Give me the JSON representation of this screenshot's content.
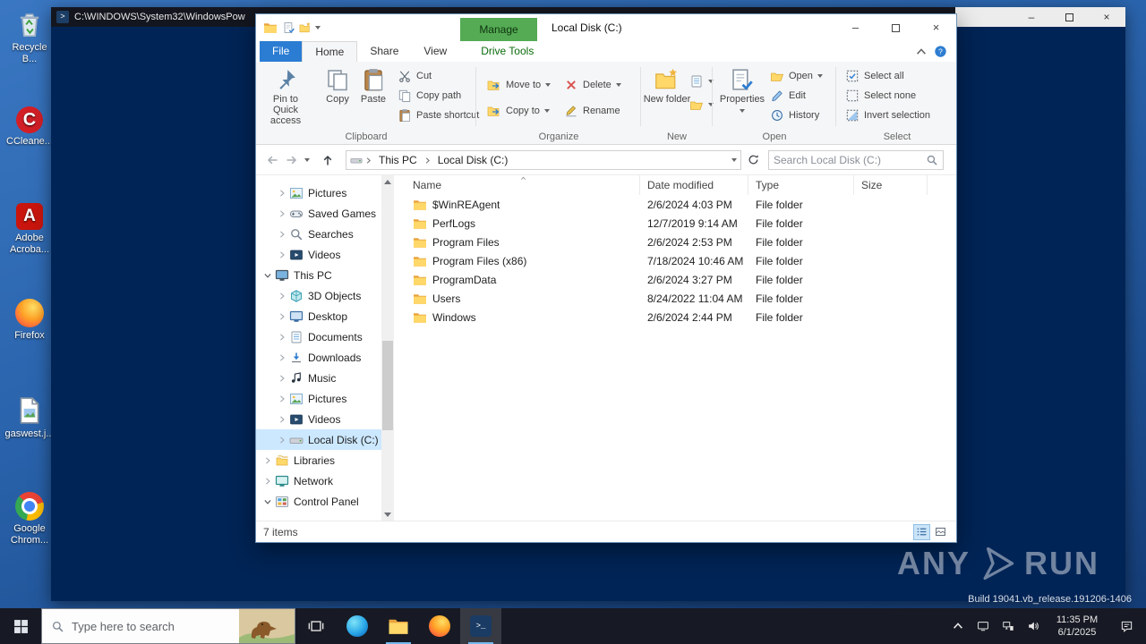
{
  "background_window": {
    "title": "C:\\WINDOWS\\System32\\WindowsPow"
  },
  "desktop": {
    "icons": [
      {
        "id": "recycle-bin",
        "label": "Recycle B..."
      },
      {
        "id": "ccleaner",
        "label": "CCleane..."
      },
      {
        "id": "adobe-acrobat",
        "label": "Adobe Acroba..."
      },
      {
        "id": "firefox",
        "label": "Firefox"
      },
      {
        "id": "gaswest-file",
        "label": "gaswest.j..."
      },
      {
        "id": "google-chrome",
        "label": "Google Chrom..."
      }
    ],
    "watermark": {
      "left": "ANY",
      "right": "RUN"
    },
    "build_watermark": "Build 19041.vb_release.191206-1406"
  },
  "explorer": {
    "title": "Local Disk (C:)",
    "contextual_chip": "Manage",
    "tabs": [
      "File",
      "Home",
      "Share",
      "View",
      "Drive Tools"
    ],
    "ribbon": {
      "clipboard": {
        "pin": "Pin to Quick access",
        "copy": "Copy",
        "paste": "Paste",
        "cut": "Cut",
        "copy_path": "Copy path",
        "paste_shortcut": "Paste shortcut",
        "group": "Clipboard"
      },
      "organize": {
        "move_to": "Move to",
        "copy_to": "Copy to",
        "delete": "Delete",
        "rename": "Rename",
        "group": "Organize"
      },
      "new": {
        "new_folder": "New folder",
        "group": "New"
      },
      "open": {
        "properties": "Properties",
        "open": "Open",
        "edit": "Edit",
        "history": "History",
        "group": "Open"
      },
      "select": {
        "select_all": "Select all",
        "select_none": "Select none",
        "invert": "Invert selection",
        "group": "Select"
      }
    },
    "address": {
      "breadcrumb": [
        "This PC",
        "Local Disk (C:)"
      ],
      "search_placeholder": "Search Local Disk (C:)"
    },
    "nav": {
      "items": [
        {
          "label": "Pictures",
          "icon": "pictures",
          "level": 1,
          "chevron": "right",
          "selected": false
        },
        {
          "label": "Saved Games",
          "icon": "saved-games",
          "level": 1,
          "chevron": "right",
          "selected": false
        },
        {
          "label": "Searches",
          "icon": "searches",
          "level": 1,
          "chevron": "right",
          "selected": false
        },
        {
          "label": "Videos",
          "icon": "videos",
          "level": 1,
          "chevron": "right",
          "selected": false
        },
        {
          "label": "This PC",
          "icon": "this-pc",
          "level": 0,
          "chevron": "down",
          "selected": false
        },
        {
          "label": "3D Objects",
          "icon": "objects-3d",
          "level": 1,
          "chevron": "right",
          "selected": false
        },
        {
          "label": "Desktop",
          "icon": "desktop",
          "level": 1,
          "chevron": "right",
          "selected": false
        },
        {
          "label": "Documents",
          "icon": "documents",
          "level": 1,
          "chevron": "right",
          "selected": false
        },
        {
          "label": "Downloads",
          "icon": "downloads",
          "level": 1,
          "chevron": "right",
          "selected": false
        },
        {
          "label": "Music",
          "icon": "music",
          "level": 1,
          "chevron": "right",
          "selected": false
        },
        {
          "label": "Pictures",
          "icon": "pictures",
          "level": 1,
          "chevron": "right",
          "selected": false
        },
        {
          "label": "Videos",
          "icon": "videos",
          "level": 1,
          "chevron": "right",
          "selected": false
        },
        {
          "label": "Local Disk (C:)",
          "icon": "drive",
          "level": 1,
          "chevron": "right",
          "selected": true
        },
        {
          "label": "Libraries",
          "icon": "libraries",
          "level": 0,
          "chevron": "right",
          "selected": false
        },
        {
          "label": "Network",
          "icon": "network",
          "level": 0,
          "chevron": "right",
          "selected": false
        },
        {
          "label": "Control Panel",
          "icon": "control-panel",
          "level": 0,
          "chevron": "down",
          "selected": false
        }
      ]
    },
    "files": {
      "columns": [
        "Name",
        "Date modified",
        "Type",
        "Size"
      ],
      "rows": [
        {
          "name": "$WinREAgent",
          "modified": "2/6/2024 4:03 PM",
          "type": "File folder",
          "size": ""
        },
        {
          "name": "PerfLogs",
          "modified": "12/7/2019 9:14 AM",
          "type": "File folder",
          "size": ""
        },
        {
          "name": "Program Files",
          "modified": "2/6/2024 2:53 PM",
          "type": "File folder",
          "size": ""
        },
        {
          "name": "Program Files (x86)",
          "modified": "7/18/2024 10:46 AM",
          "type": "File folder",
          "size": ""
        },
        {
          "name": "ProgramData",
          "modified": "2/6/2024 3:27 PM",
          "type": "File folder",
          "size": ""
        },
        {
          "name": "Users",
          "modified": "8/24/2022 11:04 AM",
          "type": "File folder",
          "size": ""
        },
        {
          "name": "Windows",
          "modified": "2/6/2024 2:44 PM",
          "type": "File folder",
          "size": ""
        }
      ]
    },
    "status": {
      "items_count": "7 items"
    }
  },
  "taskbar": {
    "search_placeholder": "Type here to search",
    "clock": {
      "time": "11:35 PM",
      "date": "6/1/2025"
    }
  }
}
